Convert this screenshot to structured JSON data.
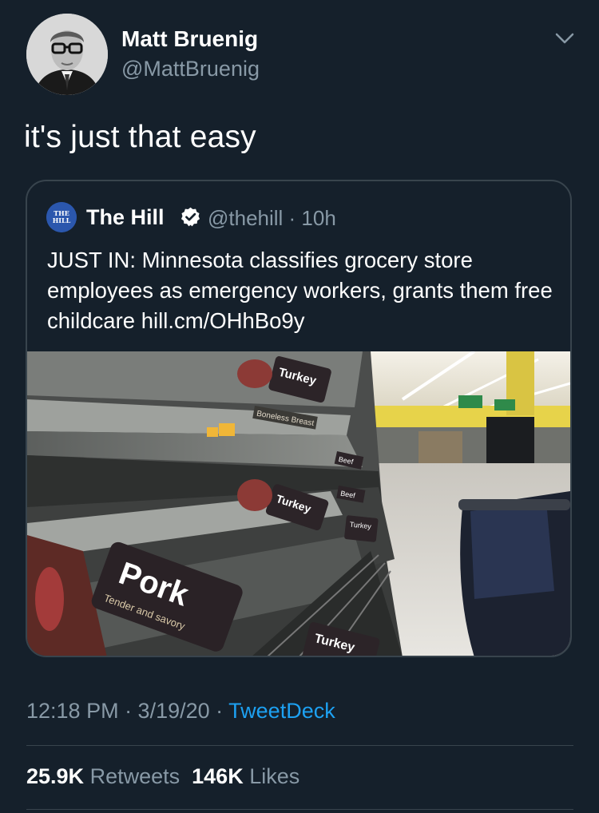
{
  "tweet": {
    "author_name": "Matt Bruenig",
    "author_handle": "@MattBruenig",
    "text": "it's just that easy",
    "timestamp": "12:18 PM · 3/19/20 · ",
    "source": "TweetDeck"
  },
  "quoted_tweet": {
    "logo_text": "THE HILL",
    "author_name": "The Hill",
    "author_handle": "@thehill · 10h",
    "text": "JUST IN: Minnesota classifies grocery store employees as emergency workers, grants them free childcare hill.cm/OHhBo9y",
    "image_labels": {
      "turkey_1": "Turkey",
      "turkey_2": "Turkey",
      "turkey_3": "Turkey",
      "turkey_4": "Turkey",
      "pork": "Pork",
      "pork_sub": "Tender and savory",
      "beef_1": "Beef",
      "beef_2": "Beef",
      "boneless": "Boneless Breast"
    }
  },
  "stats": {
    "retweets_count": "25.9K",
    "retweets_label": " Retweets",
    "likes_count": "146K",
    "likes_label": " Likes"
  },
  "icons": {
    "menu": "chevron-down-icon",
    "verified": "verified-badge-icon"
  },
  "colors": {
    "background": "#15202b",
    "secondary_text": "#8899a6",
    "link": "#1da1f2",
    "border": "#38444d"
  }
}
